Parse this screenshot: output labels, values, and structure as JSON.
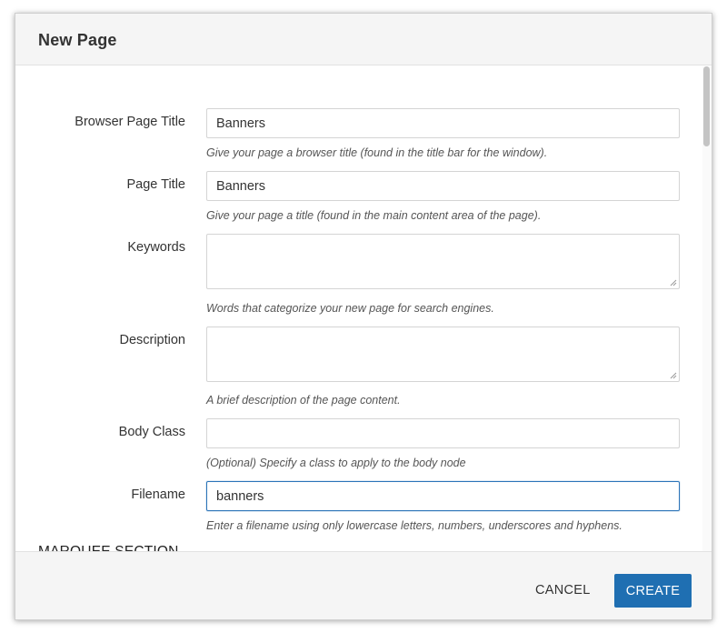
{
  "dialog": {
    "title": "New Page"
  },
  "form": {
    "browser_page_title": {
      "label": "Browser Page Title",
      "value": "Banners",
      "help": "Give your page a browser title (found in the title bar for the window)."
    },
    "page_title": {
      "label": "Page Title",
      "value": "Banners",
      "help": "Give your page a title (found in the main content area of the page)."
    },
    "keywords": {
      "label": "Keywords",
      "value": "",
      "help": "Words that categorize your new page for search engines."
    },
    "description": {
      "label": "Description",
      "value": "",
      "help": "A brief description of the page content."
    },
    "body_class": {
      "label": "Body Class",
      "value": "",
      "help": "(Optional) Specify a class to apply to the body node"
    },
    "filename": {
      "label": "Filename",
      "value": "banners",
      "help": "Enter a filename using only lowercase letters, numbers, underscores and hyphens."
    }
  },
  "sections": {
    "marquee_title": "MARQUEE SECTION"
  },
  "footer": {
    "cancel_label": "CANCEL",
    "create_label": "CREATE"
  },
  "colors": {
    "primary": "#1f6fb2",
    "focus_border": "#2b74b8",
    "header_bg": "#f5f5f5"
  },
  "icons": {
    "resize_grip": "resize-grip-icon"
  }
}
